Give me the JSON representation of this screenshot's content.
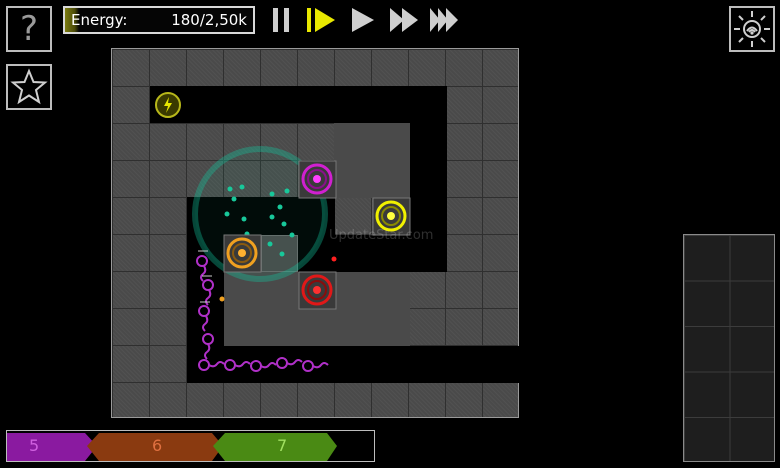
{
  "hud": {
    "help_label": "?",
    "energy_label": "Energy:",
    "energy_value": "180/2,50k",
    "energy_fraction": 0.072
  },
  "controls": [
    {
      "name": "pause-button",
      "icon": "pause-icon"
    },
    {
      "name": "play-slow-button",
      "icon": "play-step-icon",
      "active": true
    },
    {
      "name": "play-button",
      "icon": "play-icon"
    },
    {
      "name": "fast-forward-button",
      "icon": "fast-forward-icon"
    },
    {
      "name": "fastest-forward-button",
      "icon": "fastest-forward-icon"
    }
  ],
  "waves": [
    {
      "label": "5",
      "color": "#8a1aa0"
    },
    {
      "label": "6",
      "color": "#8a3a10"
    },
    {
      "label": "7",
      "color": "#4a8a14"
    }
  ],
  "watermark": "UpdateStar.com",
  "colors": {
    "energy": "#c8c81e",
    "tower_magenta": "#d020d0",
    "tower_yellow": "#f0f000",
    "tower_orange": "#f0a020",
    "tower_red": "#e01818",
    "creep": "#b030c8",
    "range": "#10c8a0"
  }
}
